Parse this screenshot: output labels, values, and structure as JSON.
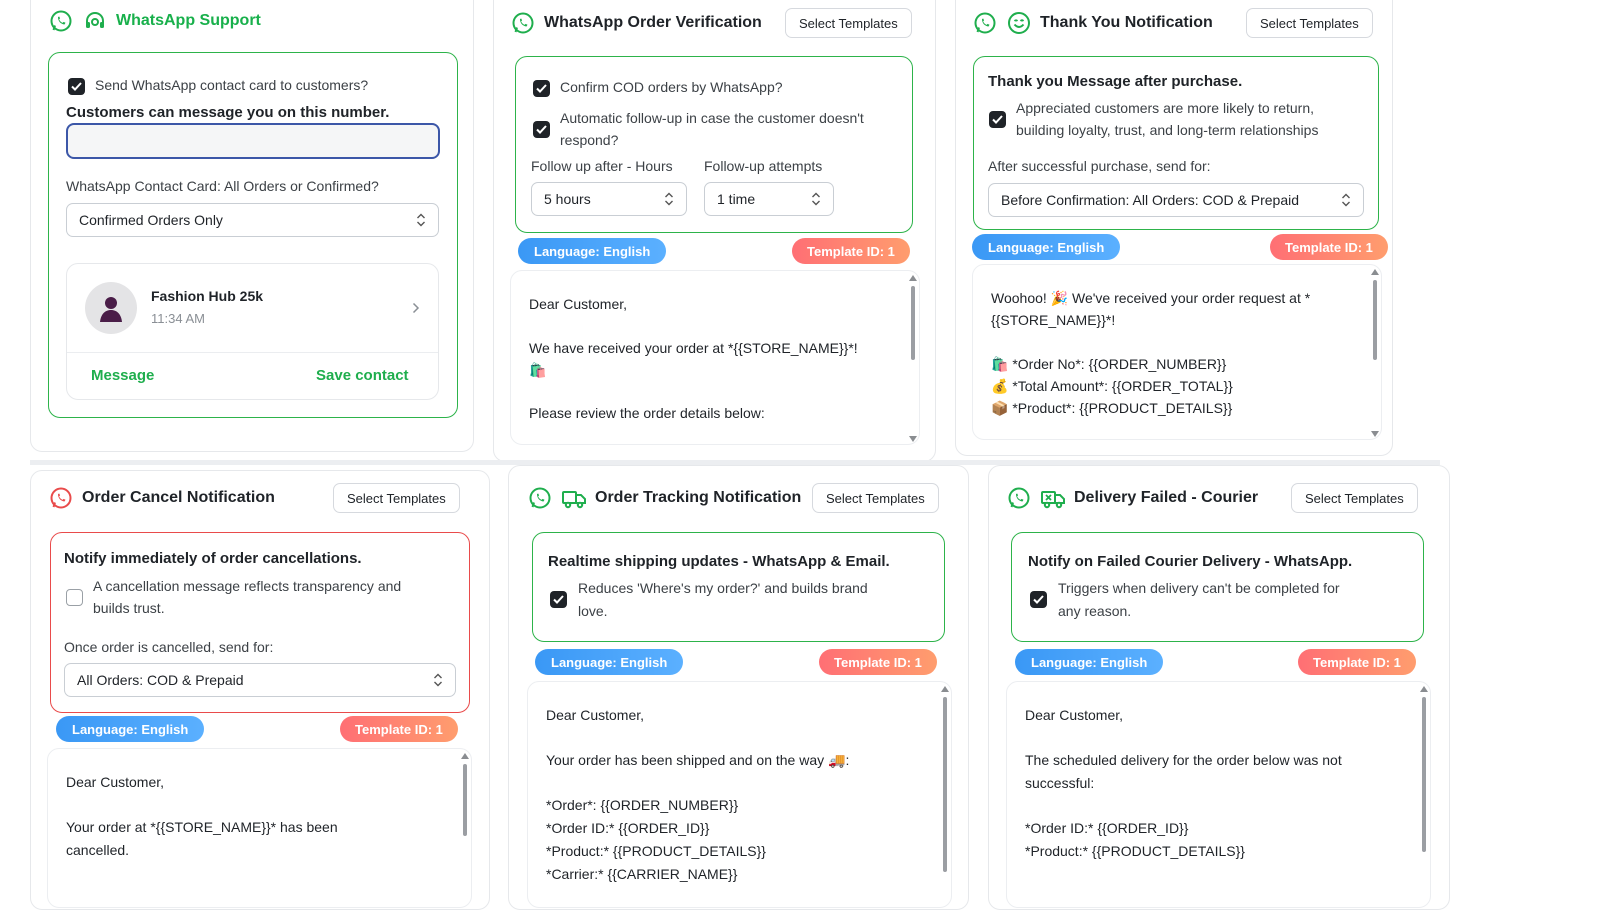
{
  "support": {
    "title": "WhatsApp Support",
    "send_card_label": "Send WhatsApp contact card to customers?",
    "number_heading": "Customers can message you on this number.",
    "contact_card_label": "WhatsApp Contact Card: All Orders or Confirmed?",
    "contact_card_select": "Confirmed Orders Only",
    "preview": {
      "name": "Fashion Hub 25k",
      "time": "11:34 AM",
      "message_action": "Message",
      "save_action": "Save contact"
    }
  },
  "verification": {
    "title": "WhatsApp Order Verification",
    "select_templates": "Select Templates",
    "confirm_cod_label": "Confirm COD orders by WhatsApp?",
    "followup_label_1": "Automatic follow-up in case the customer doesn't",
    "followup_label_2": "respond?",
    "hours_label": "Follow up after - Hours",
    "attempts_label": "Follow-up attempts",
    "hours_value": "5 hours",
    "attempts_value": "1 time",
    "language": "Language: English",
    "template_id": "Template ID: 1",
    "message": [
      "Dear Customer,",
      "We have received your order at *{{STORE_NAME}}*!",
      "🛍️",
      "Please review the order details below:"
    ]
  },
  "thankyou": {
    "title": "Thank You Notification",
    "select_templates": "Select Templates",
    "box_title": "Thank you Message after purchase.",
    "desc_1": "Appreciated customers are more likely to return,",
    "desc_2": "building loyalty, trust, and long-term relationships",
    "send_for_label": "After successful purchase, send for:",
    "send_for_value": "Before Confirmation: All Orders: COD & Prepaid",
    "language": "Language: English",
    "template_id": "Template ID: 1",
    "message": [
      "Woohoo! 🎉 We've received your order request at *",
      "{{STORE_NAME}}*!",
      "🛍️ *Order No*: {{ORDER_NUMBER}}",
      "💰 *Total Amount*: {{ORDER_TOTAL}}",
      "📦 *Product*: {{PRODUCT_DETAILS}}"
    ]
  },
  "cancel": {
    "title": "Order Cancel Notification",
    "select_templates": "Select Templates",
    "box_title": "Notify immediately of order cancellations.",
    "desc_1": "A cancellation message reflects transparency and",
    "desc_2": "builds trust.",
    "send_for_label": "Once order is cancelled, send for:",
    "send_for_value": "All Orders: COD & Prepaid",
    "language": "Language: English",
    "template_id": "Template ID: 1",
    "message": [
      "Dear Customer,",
      "Your order at *{{STORE_NAME}}* has been",
      "cancelled."
    ]
  },
  "tracking": {
    "title": "Order Tracking Notification",
    "select_templates": "Select Templates",
    "box_title": "Realtime shipping updates - WhatsApp & Email.",
    "desc_1": "Reduces 'Where's my order?' and builds brand",
    "desc_2": "love.",
    "language": "Language: English",
    "template_id": "Template ID: 1",
    "message": [
      "Dear Customer,",
      "Your order has been shipped and on the way 🚚:",
      "*Order*: {{ORDER_NUMBER}}",
      "*Order ID:* {{ORDER_ID}}",
      "*Product:* {{PRODUCT_DETAILS}}",
      "*Carrier:* {{CARRIER_NAME}}"
    ]
  },
  "failed": {
    "title": "Delivery Failed - Courier",
    "select_templates": "Select Templates",
    "box_title": "Notify on Failed Courier Delivery - WhatsApp.",
    "desc_1": "Triggers when delivery can't be completed for",
    "desc_2": "any reason.",
    "language": "Language: English",
    "template_id": "Template ID: 1",
    "message": [
      "Dear Customer,",
      "The scheduled delivery for the order below was not",
      "successful:",
      "*Order ID:* {{ORDER_ID}}",
      "*Product:* {{PRODUCT_DETAILS}}"
    ]
  },
  "colors": {
    "whatsapp_green": "#1fae4d",
    "cancel_red": "#e94b4b",
    "language_blue": "#3a98f5",
    "template_coral": "#ff7a72"
  }
}
